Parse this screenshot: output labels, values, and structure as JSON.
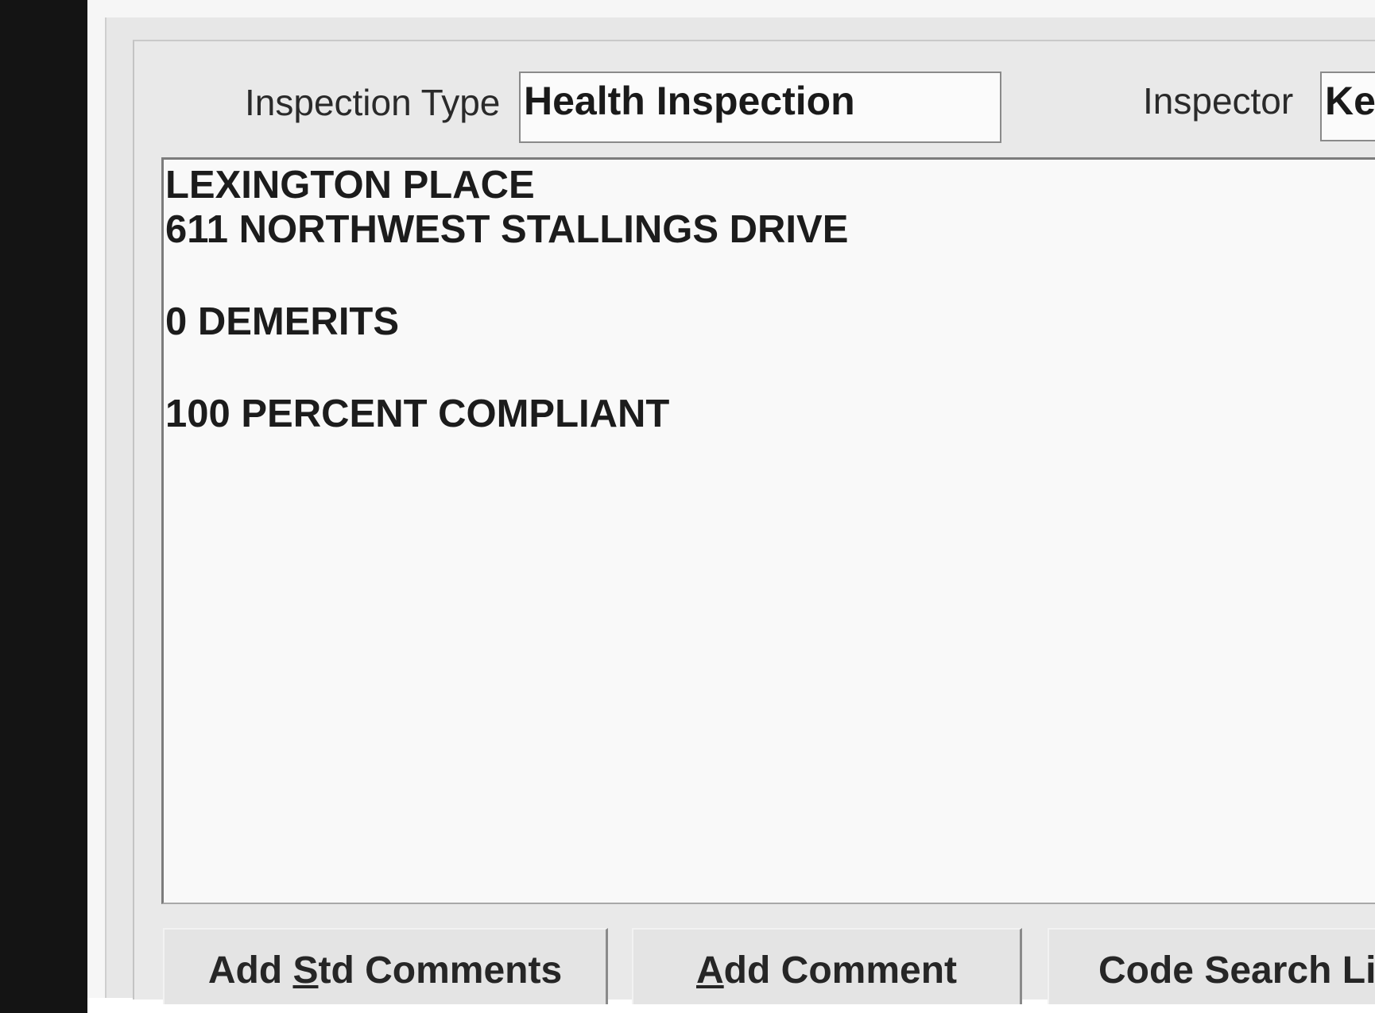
{
  "header": {
    "inspection_type_label": "Inspection Type",
    "inspection_type_value": "Health Inspection",
    "inspector_label": "Inspector",
    "inspector_value": "Ke"
  },
  "comments": {
    "lines": [
      "LEXINGTON PLACE",
      "611 NORTHWEST STALLINGS DRIVE",
      "0 DEMERITS",
      "100 PERCENT COMPLIANT"
    ]
  },
  "buttons": {
    "add_std_comments": {
      "pre": "Add ",
      "mnemonic": "S",
      "post": "td Comments"
    },
    "add_comment": {
      "pre": "",
      "mnemonic": "A",
      "post": "dd Comment"
    },
    "code_search": {
      "label": "Code Search Li"
    }
  }
}
